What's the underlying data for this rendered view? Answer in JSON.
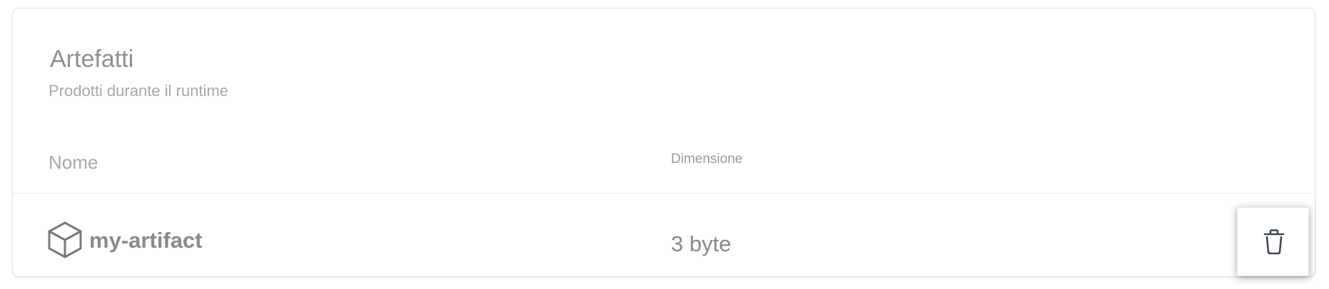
{
  "card": {
    "title": "Artefatti",
    "subtitle": "Prodotti durante il runtime"
  },
  "table": {
    "columns": {
      "name": "Nome",
      "size": "Dimensione"
    },
    "rows": [
      {
        "icon": "cube-icon",
        "name": "my-artifact",
        "size": "3 byte",
        "action_icon": "trash-icon"
      }
    ]
  },
  "colors": {
    "text_primary": "#8a8a8a",
    "text_muted": "#a8a8a8",
    "border": "#e3e3e3",
    "icon": "#7a7a7a",
    "action_icon": "#3f4853"
  }
}
